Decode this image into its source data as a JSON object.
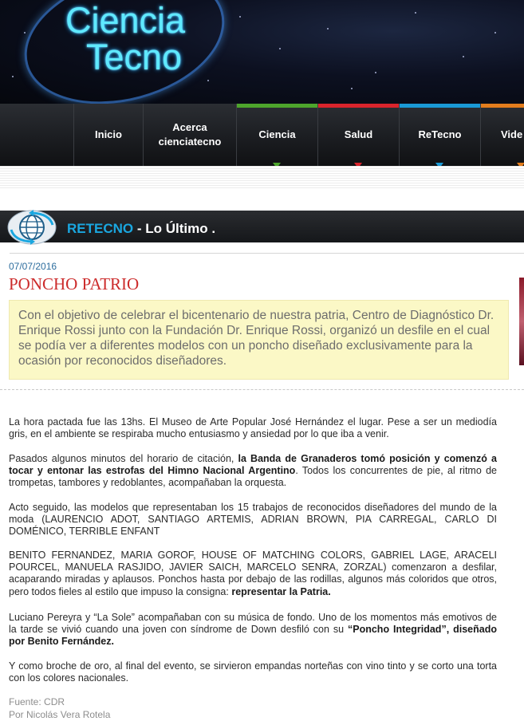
{
  "header": {
    "logo_line1": "Ciencia",
    "logo_line2": "Tecno"
  },
  "nav": {
    "items": [
      {
        "label": "Inicio",
        "bar_color": null
      },
      {
        "label": "Acerca\ncienciatecno",
        "bar_color": null
      },
      {
        "label": "Ciencia",
        "bar_color": "#4da52c"
      },
      {
        "label": "Salud",
        "bar_color": "#d9242c"
      },
      {
        "label": "ReTecno",
        "bar_color": "#1a9ad6"
      },
      {
        "label": "Vide",
        "bar_color": "#e37d1d"
      }
    ]
  },
  "section": {
    "highlight": "RETECNO",
    "rest": " - Lo Último ."
  },
  "article": {
    "date": "07/07/2016",
    "title": "PONCHO PATRIO",
    "summary": "Con el objetivo de celebrar el bicentenario de nuestra patria, Centro de Diagnóstico Dr. Enrique Rossi junto con la Fundación Dr. Enrique Rossi, organizó un desfile en el cual se podía ver a diferentes modelos con un poncho diseñado exclusivamente para la ocasión por reconocidos diseñadores.",
    "p1": "La hora pactada fue las 13hs. El Museo de Arte Popular José Hernández el lugar. Pese a ser un mediodía gris, en el ambiente se respiraba mucho entusiasmo y ansiedad por lo que iba a venir.",
    "p2_a": "Pasados algunos minutos del horario de citación, ",
    "p2_b": "la Banda de Granaderos tomó posición y comenzó a tocar y entonar las estrofas del Himno Nacional Argentino",
    "p2_c": ". Todos los concurrentes de pie, al ritmo de trompetas, tambores y redoblantes, acompañaban la orquesta.",
    "p3": "Acto seguido, las modelos que representaban los 15 trabajos de reconocidos diseñadores del mundo de la moda (LAURENCIO ADOT, SANTIAGO ARTEMIS, ADRIAN BROWN, PIA CARREGAL, CARLO DI DOMÉNICO, TERRIBLE ENFANT",
    "p4_a": "BENITO FERNANDEZ, MARIA GOROF, HOUSE OF MATCHING COLORS, GABRIEL LAGE, ARACELI POURCEL, MANUELA RASJIDO, JAVIER SAICH, MARCELO SENRA, ZORZAL) comenzaron a desfilar, acaparando miradas y aplausos. Ponchos hasta por debajo de las rodillas, algunos más coloridos que otros, pero todos fieles al estilo que impuso la consigna: ",
    "p4_b": "representar la Patria.",
    "p5_a": "Luciano Pereyra y “La Sole” acompañaban con su música de fondo. Uno de los momentos más emotivos de la tarde se vivió cuando una joven con síndrome de Down desfiló con su ",
    "p5_b": "“Poncho Integridad”, diseñado por Benito Fernández.",
    "p6": "Y como broche de oro, al final del evento, se sirvieron empandas norteñas con vino tinto y se corto una torta con los colores nacionales.",
    "source": "Fuente: CDR",
    "author": "Por Nicolás Vera Rotela"
  }
}
